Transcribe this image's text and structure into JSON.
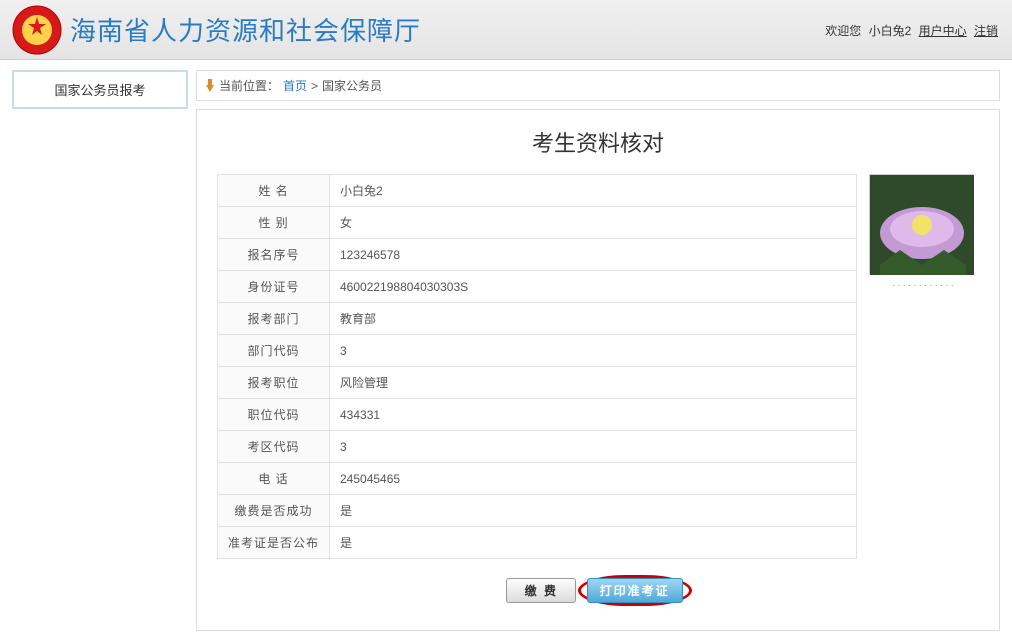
{
  "header": {
    "site_title": "海南省人力资源和社会保障厅",
    "welcome": "欢迎您",
    "username": "小白兔2",
    "user_center": "用户中心",
    "logout": "注销"
  },
  "sidebar": {
    "items": [
      {
        "label": "国家公务员报考"
      }
    ]
  },
  "breadcrumb": {
    "label": "当前位置：",
    "home": "首页",
    "sep": ">",
    "current": "国家公务员"
  },
  "panel": {
    "title": "考生资料核对"
  },
  "fields": [
    {
      "label": "姓 名",
      "value": "小白兔2"
    },
    {
      "label": "性 别",
      "value": "女"
    },
    {
      "label": "报名序号",
      "value": "123246578"
    },
    {
      "label": "身份证号",
      "value": "460022198804030303S"
    },
    {
      "label": "报考部门",
      "value": "教育部"
    },
    {
      "label": "部门代码",
      "value": "3"
    },
    {
      "label": "报考职位",
      "value": "风险管理"
    },
    {
      "label": "职位代码",
      "value": "434331"
    },
    {
      "label": "考区代码",
      "value": "3"
    },
    {
      "label": "电 话",
      "value": "245045465"
    },
    {
      "label": "缴费是否成功",
      "value": "是"
    },
    {
      "label": "准考证是否公布",
      "value": "是"
    }
  ],
  "photo": {
    "caption": "············"
  },
  "actions": {
    "pay": "缴 费",
    "print": "打印准考证"
  }
}
